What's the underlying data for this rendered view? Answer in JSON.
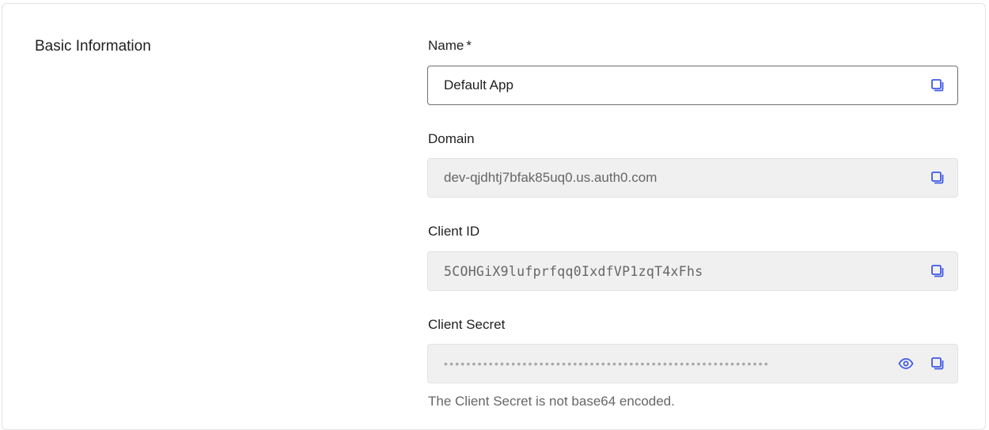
{
  "section": {
    "title": "Basic Information"
  },
  "fields": {
    "name": {
      "label": "Name",
      "required_marker": "*",
      "value": "Default App"
    },
    "domain": {
      "label": "Domain",
      "value": "dev-qjdhtj7bfak85uq0.us.auth0.com"
    },
    "client_id": {
      "label": "Client ID",
      "value": "5COHGiX9lufprfqq0IxdfVP1zqT4xFhs"
    },
    "client_secret": {
      "label": "Client Secret",
      "masked_value": "••••••••••••••••••••••••••••••••••••••••••••••••••••••••••",
      "helper": "The Client Secret is not base64 encoded."
    }
  },
  "icons": {
    "copy": "copy-icon",
    "reveal": "eye-icon"
  },
  "colors": {
    "icon_accent": "#3F59E4",
    "readonly_bg": "#F0F0F0",
    "editable_border": "#6F6F6F"
  }
}
